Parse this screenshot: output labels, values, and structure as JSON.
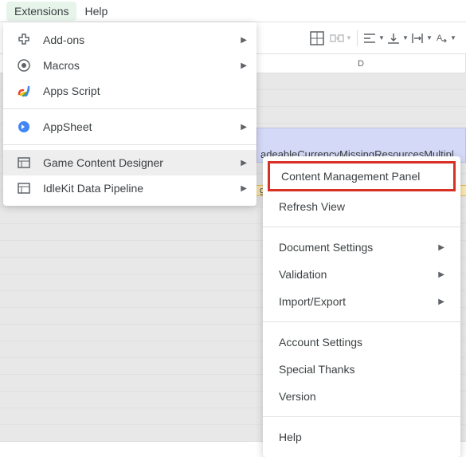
{
  "menubar": {
    "extensions": "Extensions",
    "help": "Help"
  },
  "columns": {
    "d": "D"
  },
  "sheet": {
    "row1_text": "adeableCurrencyMissingResourcesMultipl",
    "row2_text": "gradeableCurrencyMissingResourcesMultipli"
  },
  "dropdown": {
    "addons": "Add-ons",
    "macros": "Macros",
    "apps_script": "Apps Script",
    "appsheet": "AppSheet",
    "game_content_designer": "Game Content Designer",
    "idlekit": "IdleKit Data Pipeline"
  },
  "submenu": {
    "content_mgmt": "Content Management Panel",
    "refresh": "Refresh View",
    "doc_settings": "Document Settings",
    "validation": "Validation",
    "import_export": "Import/Export",
    "account": "Account Settings",
    "thanks": "Special Thanks",
    "version": "Version",
    "help": "Help"
  }
}
